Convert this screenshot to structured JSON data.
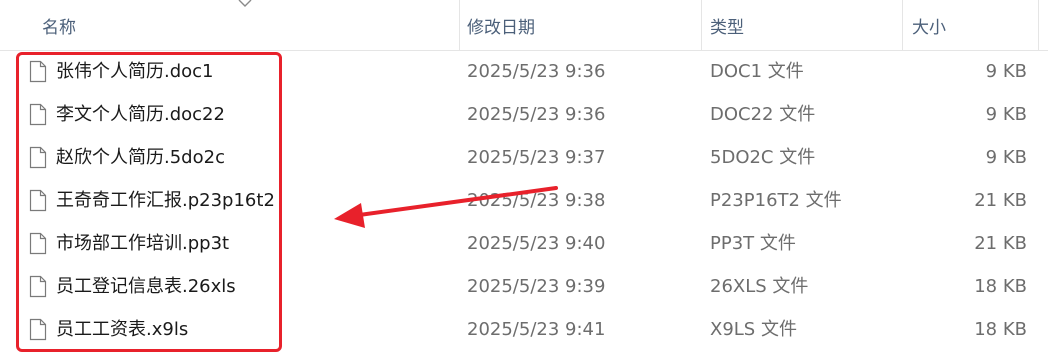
{
  "columns": {
    "name": "名称",
    "date": "修改日期",
    "type": "类型",
    "size": "大小"
  },
  "files": [
    {
      "name": "张伟个人简历.doc1",
      "date": "2025/5/23 9:36",
      "type": "DOC1 文件",
      "size": "9 KB"
    },
    {
      "name": "李文个人简历.doc22",
      "date": "2025/5/23 9:36",
      "type": "DOC22 文件",
      "size": "9 KB"
    },
    {
      "name": "赵欣个人简历.5do2c",
      "date": "2025/5/23 9:37",
      "type": "5DO2C 文件",
      "size": "9 KB"
    },
    {
      "name": "王奇奇工作汇报.p23p16t2",
      "date": "2025/5/23 9:38",
      "type": "P23P16T2 文件",
      "size": "21 KB"
    },
    {
      "name": "市场部工作培训.pp3t",
      "date": "2025/5/23 9:40",
      "type": "PP3T 文件",
      "size": "21 KB"
    },
    {
      "name": "员工登记信息表.26xls",
      "date": "2025/5/23 9:39",
      "type": "26XLS 文件",
      "size": "18 KB"
    },
    {
      "name": "员工工资表.x9ls",
      "date": "2025/5/23 9:41",
      "type": "X9LS 文件",
      "size": "18 KB"
    }
  ],
  "icons": {
    "file": "document-icon",
    "sort": "chevron-down-icon"
  },
  "colors": {
    "annotation": "#e8212b",
    "header_text": "#4c607a",
    "secondary_text": "#6d6d6d"
  }
}
